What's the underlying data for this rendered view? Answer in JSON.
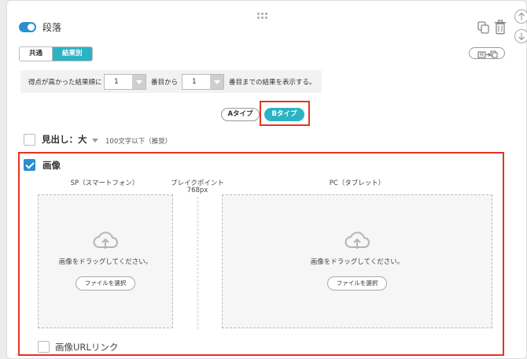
{
  "block": {
    "title": "段落"
  },
  "tabs": {
    "common": "共通",
    "by_result": "結果別"
  },
  "filter": {
    "prefix": "得点が高かった結果順に",
    "from_value": "1",
    "from_suffix": "番目から",
    "to_value": "1",
    "to_suffix": "番目までの結果を表示する。"
  },
  "types": {
    "a": "Aタイプ",
    "b": "Bタイプ"
  },
  "heading": {
    "label": "見出し：大",
    "hint": "100文字以下（推奨）"
  },
  "image": {
    "label": "画像",
    "breakpoint_label": "ブレイクポイント",
    "breakpoint_value": "768px",
    "sp": {
      "label": "SP（スマートフォン）",
      "message": "画像をドラッグしてください。",
      "button": "ファイルを選択"
    },
    "pc": {
      "label": "PC（タブレット）",
      "message": "画像をドラッグしてください。",
      "button": "ファイルを選択"
    }
  },
  "image_url_link": {
    "label": "画像URLリンク"
  },
  "colors": {
    "accent": "#2db2c4",
    "toggle": "#2a8fcf",
    "highlight": "#e53322"
  },
  "icons": [
    "drag-handle-icon",
    "copy-icon",
    "trash-icon",
    "swap-icon",
    "cloud-upload-icon",
    "chevron-down-icon",
    "arrow-up-icon",
    "arrow-down-icon"
  ]
}
